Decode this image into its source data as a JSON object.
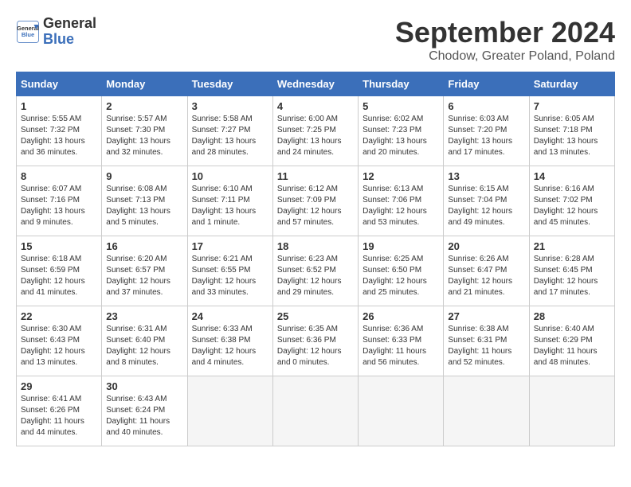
{
  "logo": {
    "line1": "General",
    "line2": "Blue"
  },
  "title": "September 2024",
  "subtitle": "Chodow, Greater Poland, Poland",
  "days_of_week": [
    "Sunday",
    "Monday",
    "Tuesday",
    "Wednesday",
    "Thursday",
    "Friday",
    "Saturday"
  ],
  "weeks": [
    [
      {
        "day": 1,
        "info": "Sunrise: 5:55 AM\nSunset: 7:32 PM\nDaylight: 13 hours\nand 36 minutes."
      },
      {
        "day": 2,
        "info": "Sunrise: 5:57 AM\nSunset: 7:30 PM\nDaylight: 13 hours\nand 32 minutes."
      },
      {
        "day": 3,
        "info": "Sunrise: 5:58 AM\nSunset: 7:27 PM\nDaylight: 13 hours\nand 28 minutes."
      },
      {
        "day": 4,
        "info": "Sunrise: 6:00 AM\nSunset: 7:25 PM\nDaylight: 13 hours\nand 24 minutes."
      },
      {
        "day": 5,
        "info": "Sunrise: 6:02 AM\nSunset: 7:23 PM\nDaylight: 13 hours\nand 20 minutes."
      },
      {
        "day": 6,
        "info": "Sunrise: 6:03 AM\nSunset: 7:20 PM\nDaylight: 13 hours\nand 17 minutes."
      },
      {
        "day": 7,
        "info": "Sunrise: 6:05 AM\nSunset: 7:18 PM\nDaylight: 13 hours\nand 13 minutes."
      }
    ],
    [
      {
        "day": 8,
        "info": "Sunrise: 6:07 AM\nSunset: 7:16 PM\nDaylight: 13 hours\nand 9 minutes."
      },
      {
        "day": 9,
        "info": "Sunrise: 6:08 AM\nSunset: 7:13 PM\nDaylight: 13 hours\nand 5 minutes."
      },
      {
        "day": 10,
        "info": "Sunrise: 6:10 AM\nSunset: 7:11 PM\nDaylight: 13 hours\nand 1 minute."
      },
      {
        "day": 11,
        "info": "Sunrise: 6:12 AM\nSunset: 7:09 PM\nDaylight: 12 hours\nand 57 minutes."
      },
      {
        "day": 12,
        "info": "Sunrise: 6:13 AM\nSunset: 7:06 PM\nDaylight: 12 hours\nand 53 minutes."
      },
      {
        "day": 13,
        "info": "Sunrise: 6:15 AM\nSunset: 7:04 PM\nDaylight: 12 hours\nand 49 minutes."
      },
      {
        "day": 14,
        "info": "Sunrise: 6:16 AM\nSunset: 7:02 PM\nDaylight: 12 hours\nand 45 minutes."
      }
    ],
    [
      {
        "day": 15,
        "info": "Sunrise: 6:18 AM\nSunset: 6:59 PM\nDaylight: 12 hours\nand 41 minutes."
      },
      {
        "day": 16,
        "info": "Sunrise: 6:20 AM\nSunset: 6:57 PM\nDaylight: 12 hours\nand 37 minutes."
      },
      {
        "day": 17,
        "info": "Sunrise: 6:21 AM\nSunset: 6:55 PM\nDaylight: 12 hours\nand 33 minutes."
      },
      {
        "day": 18,
        "info": "Sunrise: 6:23 AM\nSunset: 6:52 PM\nDaylight: 12 hours\nand 29 minutes."
      },
      {
        "day": 19,
        "info": "Sunrise: 6:25 AM\nSunset: 6:50 PM\nDaylight: 12 hours\nand 25 minutes."
      },
      {
        "day": 20,
        "info": "Sunrise: 6:26 AM\nSunset: 6:47 PM\nDaylight: 12 hours\nand 21 minutes."
      },
      {
        "day": 21,
        "info": "Sunrise: 6:28 AM\nSunset: 6:45 PM\nDaylight: 12 hours\nand 17 minutes."
      }
    ],
    [
      {
        "day": 22,
        "info": "Sunrise: 6:30 AM\nSunset: 6:43 PM\nDaylight: 12 hours\nand 13 minutes."
      },
      {
        "day": 23,
        "info": "Sunrise: 6:31 AM\nSunset: 6:40 PM\nDaylight: 12 hours\nand 8 minutes."
      },
      {
        "day": 24,
        "info": "Sunrise: 6:33 AM\nSunset: 6:38 PM\nDaylight: 12 hours\nand 4 minutes."
      },
      {
        "day": 25,
        "info": "Sunrise: 6:35 AM\nSunset: 6:36 PM\nDaylight: 12 hours\nand 0 minutes."
      },
      {
        "day": 26,
        "info": "Sunrise: 6:36 AM\nSunset: 6:33 PM\nDaylight: 11 hours\nand 56 minutes."
      },
      {
        "day": 27,
        "info": "Sunrise: 6:38 AM\nSunset: 6:31 PM\nDaylight: 11 hours\nand 52 minutes."
      },
      {
        "day": 28,
        "info": "Sunrise: 6:40 AM\nSunset: 6:29 PM\nDaylight: 11 hours\nand 48 minutes."
      }
    ],
    [
      {
        "day": 29,
        "info": "Sunrise: 6:41 AM\nSunset: 6:26 PM\nDaylight: 11 hours\nand 44 minutes."
      },
      {
        "day": 30,
        "info": "Sunrise: 6:43 AM\nSunset: 6:24 PM\nDaylight: 11 hours\nand 40 minutes."
      },
      null,
      null,
      null,
      null,
      null
    ]
  ]
}
